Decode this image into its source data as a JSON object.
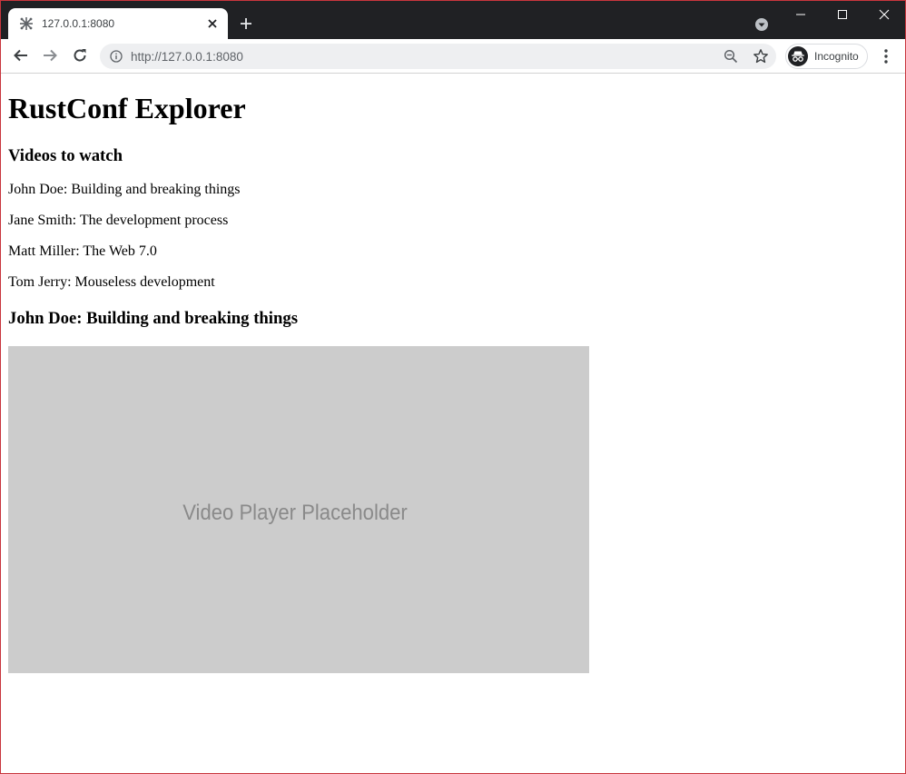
{
  "browser": {
    "tab": {
      "title": "127.0.0.1:8080",
      "favicon": "snowflake-icon"
    },
    "address_bar": {
      "url": "http://127.0.0.1:8080"
    },
    "profile": {
      "label": "Incognito"
    },
    "colors": {
      "title_bar": "#202124",
      "window_border": "#c8363d",
      "omnibox": "#eeeff1"
    }
  },
  "page": {
    "title": "RustConf Explorer",
    "videos_heading": "Videos to watch",
    "videos": [
      {
        "label": "John Doe: Building and breaking things"
      },
      {
        "label": "Jane Smith: The development process"
      },
      {
        "label": "Matt Miller: The Web 7.0"
      },
      {
        "label": "Tom Jerry: Mouseless development"
      }
    ],
    "selected_video_heading": "John Doe: Building and breaking things",
    "player": {
      "placeholder": "Video Player Placeholder",
      "background": "#cccccc"
    }
  }
}
